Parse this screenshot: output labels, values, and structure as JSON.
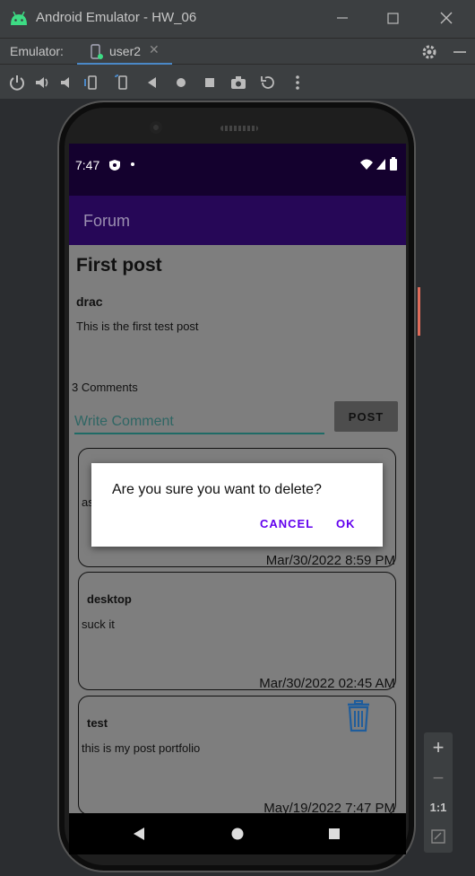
{
  "window": {
    "title": "Android Emulator - HW_06",
    "controls": [
      "minimize-icon",
      "maximize-icon",
      "close-icon"
    ]
  },
  "tabbar": {
    "label": "Emulator:",
    "tab_name": "user2",
    "tab_close": "✕"
  },
  "toolbar": {
    "icons": [
      "power-icon",
      "volume-up-icon",
      "volume-down-icon",
      "rotate-left-icon",
      "rotate-right-icon",
      "back-icon",
      "home-icon",
      "overview-icon",
      "camera-icon",
      "replay-icon",
      "more-icon"
    ]
  },
  "status": {
    "time": "7:47"
  },
  "app": {
    "title": "Forum"
  },
  "post": {
    "title": "First post",
    "author": "drac",
    "body": "This is the first test post",
    "comment_count": "3 Comments"
  },
  "comment_form": {
    "placeholder": "Write Comment",
    "post_label": "POST"
  },
  "comments": [
    {
      "author": "",
      "body": "as",
      "date": "Mar/30/2022 8:59 PM"
    },
    {
      "author": "desktop",
      "body": "suck it",
      "date": "Mar/30/2022 02:45 AM"
    },
    {
      "author": "test",
      "body": "this is my post portfolio",
      "date": "May/19/2022 7:47 PM"
    }
  ],
  "dialog": {
    "message": "Are you sure you want to delete?",
    "cancel": "CANCEL",
    "ok": "OK"
  },
  "zoom": {
    "plus": "+",
    "minus": "−",
    "one_to_one": "1:1"
  },
  "colors": {
    "status_bar": "#14012e",
    "app_bar": "#260757",
    "accent": "#6200ee",
    "input_underline": "#1f6b66",
    "trash": "#1f5d9c"
  }
}
